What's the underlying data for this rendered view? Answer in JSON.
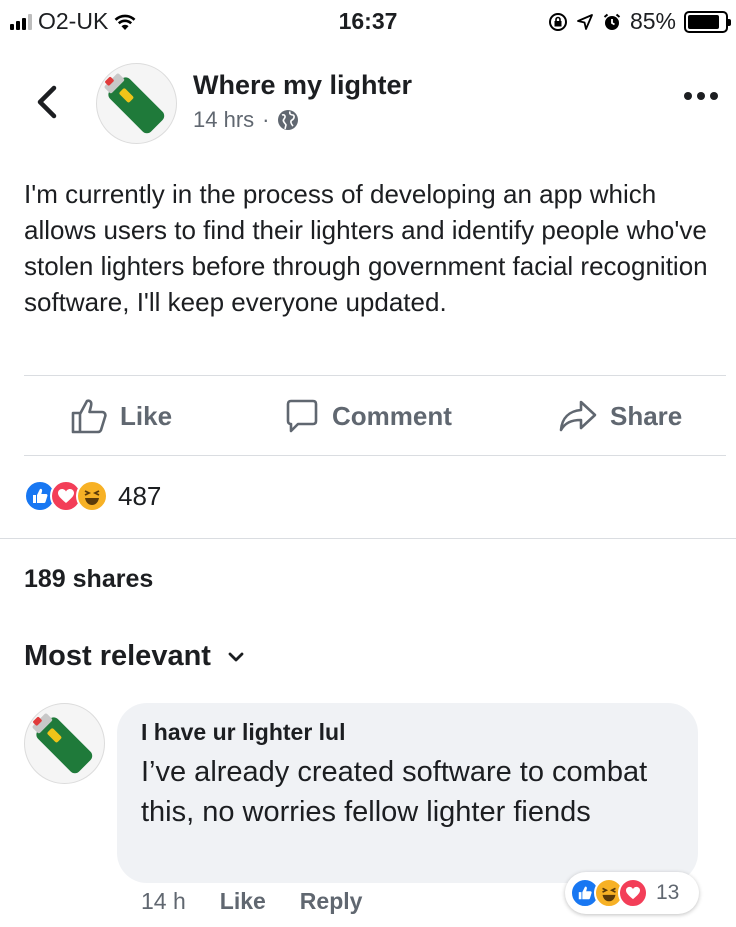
{
  "status_bar": {
    "carrier": "O2-UK",
    "time": "16:37",
    "battery": "85%",
    "battery_level": 0.85
  },
  "post": {
    "author": "Where my lighter",
    "time": "14 hrs",
    "separator": "·",
    "text": "I'm currently in the process of developing an app which allows users to find their lighters and identify people who've stolen lighters before through government facial recognition software, I'll keep everyone updated.",
    "actions": {
      "like": "Like",
      "comment": "Comment",
      "share": "Share"
    },
    "reaction_count": "487",
    "shares": "189 shares"
  },
  "comments_section": {
    "sort_label": "Most relevant"
  },
  "comment": {
    "author": "I have ur lighter lul",
    "text": "I’ve already created software to combat this, no worries fellow lighter fiends",
    "time": "14 h",
    "like": "Like",
    "reply": "Reply",
    "reaction_count": "13"
  },
  "colors": {
    "like_blue": "#1877f2",
    "love_red": "#f33e58",
    "haha_yellow": "#f7b125",
    "lighter_green": "#1f7a3a",
    "muted_text": "#606770"
  }
}
